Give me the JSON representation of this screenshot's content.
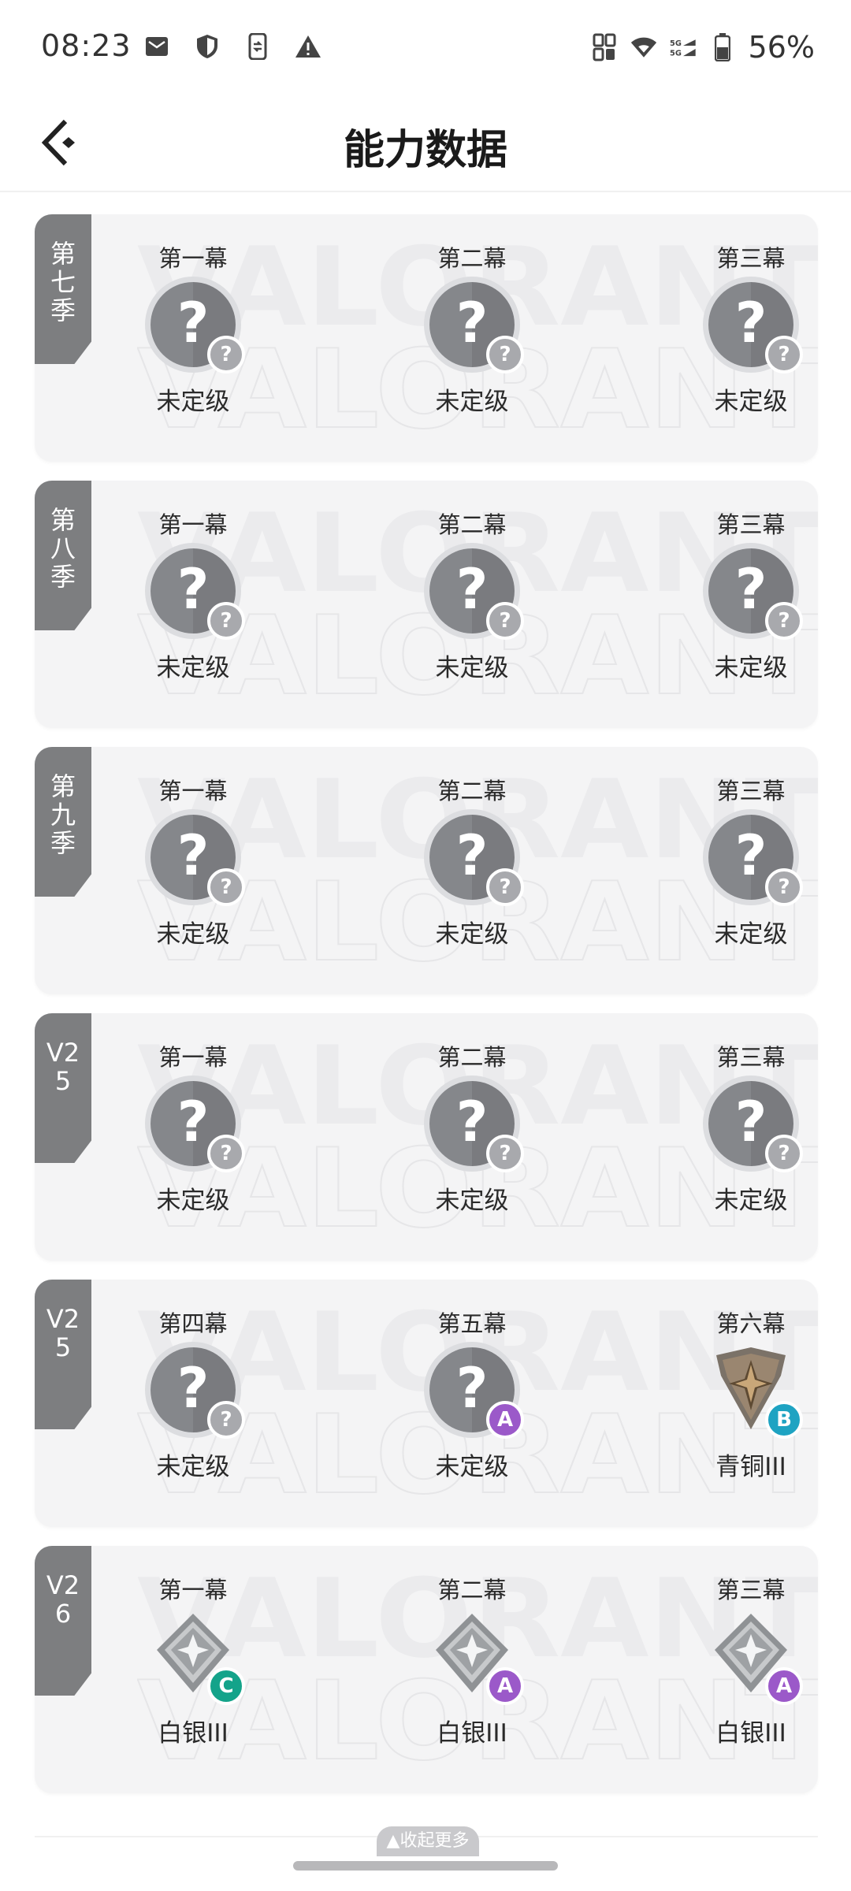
{
  "status_bar": {
    "time": "08:23",
    "battery": "56%",
    "network": "5G",
    "left_icons": [
      "mail-icon",
      "shield-icon",
      "phone-transfer-icon",
      "warning-icon"
    ],
    "right_icons": [
      "data-saver-icon",
      "wifi-icon",
      "signal-icon",
      "battery-icon"
    ]
  },
  "header": {
    "title": "能力数据"
  },
  "cards": [
    {
      "season": "第七季",
      "acts": [
        {
          "label": "第一幕",
          "rank": "未定级",
          "badge": "?",
          "badge_color": "#a8a9ad",
          "tier": "unranked"
        },
        {
          "label": "第二幕",
          "rank": "未定级",
          "badge": "?",
          "badge_color": "#a8a9ad",
          "tier": "unranked"
        },
        {
          "label": "第三幕",
          "rank": "未定级",
          "badge": "?",
          "badge_color": "#a8a9ad",
          "tier": "unranked"
        }
      ]
    },
    {
      "season": "第八季",
      "acts": [
        {
          "label": "第一幕",
          "rank": "未定级",
          "badge": "?",
          "badge_color": "#a8a9ad",
          "tier": "unranked"
        },
        {
          "label": "第二幕",
          "rank": "未定级",
          "badge": "?",
          "badge_color": "#a8a9ad",
          "tier": "unranked"
        },
        {
          "label": "第三幕",
          "rank": "未定级",
          "badge": "?",
          "badge_color": "#a8a9ad",
          "tier": "unranked"
        }
      ]
    },
    {
      "season": "第九季",
      "acts": [
        {
          "label": "第一幕",
          "rank": "未定级",
          "badge": "?",
          "badge_color": "#a8a9ad",
          "tier": "unranked"
        },
        {
          "label": "第二幕",
          "rank": "未定级",
          "badge": "?",
          "badge_color": "#a8a9ad",
          "tier": "unranked"
        },
        {
          "label": "第三幕",
          "rank": "未定级",
          "badge": "?",
          "badge_color": "#a8a9ad",
          "tier": "unranked"
        }
      ]
    },
    {
      "season": "V25",
      "acts": [
        {
          "label": "第一幕",
          "rank": "未定级",
          "badge": "?",
          "badge_color": "#a8a9ad",
          "tier": "unranked"
        },
        {
          "label": "第二幕",
          "rank": "未定级",
          "badge": "?",
          "badge_color": "#a8a9ad",
          "tier": "unranked"
        },
        {
          "label": "第三幕",
          "rank": "未定级",
          "badge": "?",
          "badge_color": "#a8a9ad",
          "tier": "unranked"
        }
      ]
    },
    {
      "season": "V25",
      "acts": [
        {
          "label": "第四幕",
          "rank": "未定级",
          "badge": "?",
          "badge_color": "#a8a9ad",
          "tier": "unranked"
        },
        {
          "label": "第五幕",
          "rank": "未定级",
          "badge": "A",
          "badge_color": "#9b59c9",
          "tier": "unranked"
        },
        {
          "label": "第六幕",
          "rank": "青铜III",
          "badge": "B",
          "badge_color": "#1ea3c2",
          "tier": "bronze"
        }
      ]
    },
    {
      "season": "V26",
      "acts": [
        {
          "label": "第一幕",
          "rank": "白银III",
          "badge": "C",
          "badge_color": "#14a38a",
          "tier": "silver"
        },
        {
          "label": "第二幕",
          "rank": "白银III",
          "badge": "A",
          "badge_color": "#9b59c9",
          "tier": "silver"
        },
        {
          "label": "第三幕",
          "rank": "白银III",
          "badge": "A",
          "badge_color": "#9b59c9",
          "tier": "silver"
        }
      ]
    }
  ],
  "watermark_text": "VALORANT",
  "footer": {
    "collapse_label": "▲收起更多"
  }
}
